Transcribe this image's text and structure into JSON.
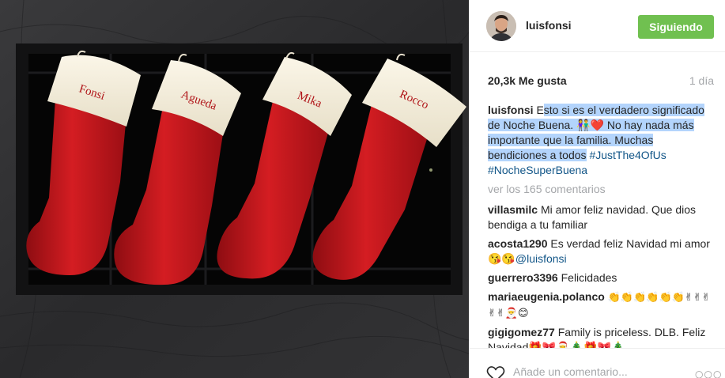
{
  "post": {
    "username": "luisfonsi",
    "follow_label": "Siguiendo",
    "likes": "20,3k Me gusta",
    "time_ago": "1 día",
    "caption": {
      "text_highlighted": "sto si es el verdadero significado de Noche Buena. 👫❤️ No hay nada más importante que la familia. Muchas bendiciones a todos",
      "first_letter": "E",
      "hashtag1": "#JustThe4OfUs",
      "hashtag2": "#NocheSuperBuena"
    },
    "view_comments_label": "ver los 165 comentarios",
    "add_comment_placeholder": "Añade un comentario...",
    "more_options": "○○○",
    "icons": {
      "like": "heart-outline-icon",
      "options": "more-options-icon"
    },
    "colors": {
      "follow_button": "#70c050",
      "link": "#125688",
      "muted": "#a5a7aa",
      "selection": "#b3d4fc",
      "stocking_red": "#c8191f"
    }
  },
  "photo": {
    "stocking_names": [
      "Fonsi",
      "Agueda",
      "Mika",
      "Rocco"
    ]
  },
  "comments": [
    {
      "user": "villasmilc",
      "text": "Mi amor feliz navidad. Que dios bendiga a tu familiar"
    },
    {
      "user": "acosta1290",
      "text": "Es verdad feliz Navidad mi amor😘😘",
      "mention": "@luisfonsi"
    },
    {
      "user": "guerrero3396",
      "text": "Felicidades"
    },
    {
      "user": "mariaeugenia.polanco",
      "text": "👏👏👏👏👏👏✌✌✌✌✌🎅😊"
    },
    {
      "user": "gigigomez77",
      "text": "Family is priceless. DLB. Feliz Navidad🎁🎀🎅🎄🎁🎀🎄"
    }
  ]
}
